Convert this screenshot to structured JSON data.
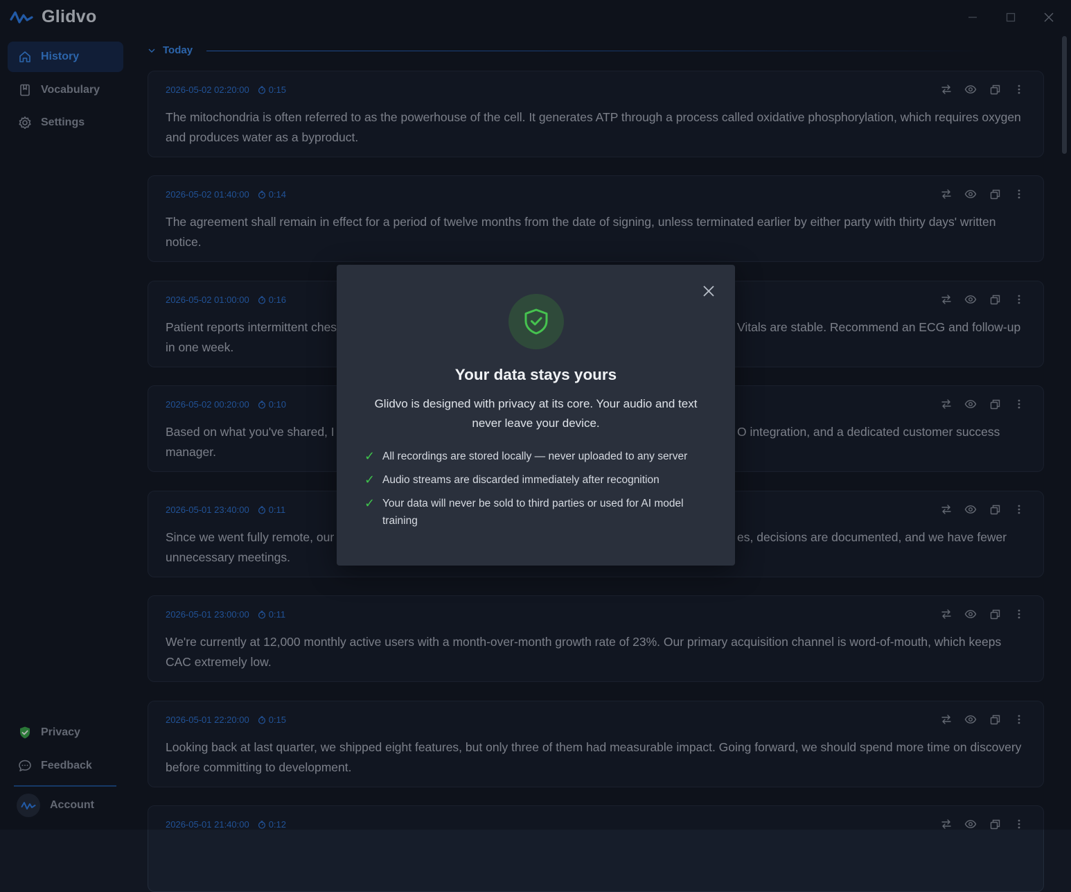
{
  "app": {
    "name": "Glidvo"
  },
  "sidebar": {
    "items": [
      {
        "label": "History",
        "icon": "home-icon",
        "active": true
      },
      {
        "label": "Vocabulary",
        "icon": "book-icon",
        "active": false
      },
      {
        "label": "Settings",
        "icon": "gear-icon",
        "active": false
      }
    ],
    "bottom": [
      {
        "label": "Privacy",
        "icon": "shield-check-icon"
      },
      {
        "label": "Feedback",
        "icon": "chat-bubble-icon"
      }
    ],
    "account_label": "Account"
  },
  "history": {
    "group_label": "Today",
    "entries": [
      {
        "timestamp": "2026-05-02 02:20:00",
        "duration": "0:15",
        "text": "The mitochondria is often referred to as the powerhouse of the cell. It generates ATP through a process called oxidative phosphorylation, which requires oxygen and produces water as a byproduct."
      },
      {
        "timestamp": "2026-05-02 01:40:00",
        "duration": "0:14",
        "text": "The agreement shall remain in effect for a period of twelve months from the date of signing, unless terminated earlier by either party with thirty days' written notice."
      },
      {
        "timestamp": "2026-05-02 01:00:00",
        "duration": "0:16",
        "text": "Patient reports intermittent ches",
        "text_right": "Vitals are stable. Recommend an ECG and follow-up",
        "text_line2": "in one week."
      },
      {
        "timestamp": "2026-05-02 00:20:00",
        "duration": "0:10",
        "text": "Based on what you've shared, I t",
        "text_right": "O integration, and a dedicated customer success",
        "text_line2": "manager."
      },
      {
        "timestamp": "2026-05-01 23:40:00",
        "duration": "0:11",
        "text": "Since we went fully remote, our",
        "text_right": "es, decisions are documented, and we have fewer",
        "text_line2": "unnecessary meetings."
      },
      {
        "timestamp": "2026-05-01 23:00:00",
        "duration": "0:11",
        "text": "We're currently at 12,000 monthly active users with a month-over-month growth rate of 23%. Our primary acquisition channel is word-of-mouth, which keeps CAC extremely low."
      },
      {
        "timestamp": "2026-05-01 22:20:00",
        "duration": "0:15",
        "text": "Looking back at last quarter, we shipped eight features, but only three of them had measurable impact. Going forward, we should spend more time on discovery before committing to development."
      },
      {
        "timestamp": "2026-05-01 21:40:00",
        "duration": "0:12",
        "text": ""
      }
    ]
  },
  "modal": {
    "title": "Your data stays yours",
    "description": "Glidvo is designed with privacy at its core. Your audio and text never leave your device.",
    "benefits": [
      "All recordings are stored locally — never uploaded to any server",
      "Audio streams are discarded immediately after recognition",
      "Your data will never be sold to third parties or used for AI model training"
    ]
  },
  "colors": {
    "accent": "#3d8ef0",
    "success": "#3fc24c",
    "background": "#121722",
    "card": "#161d2a",
    "modal": "#2a303c"
  }
}
